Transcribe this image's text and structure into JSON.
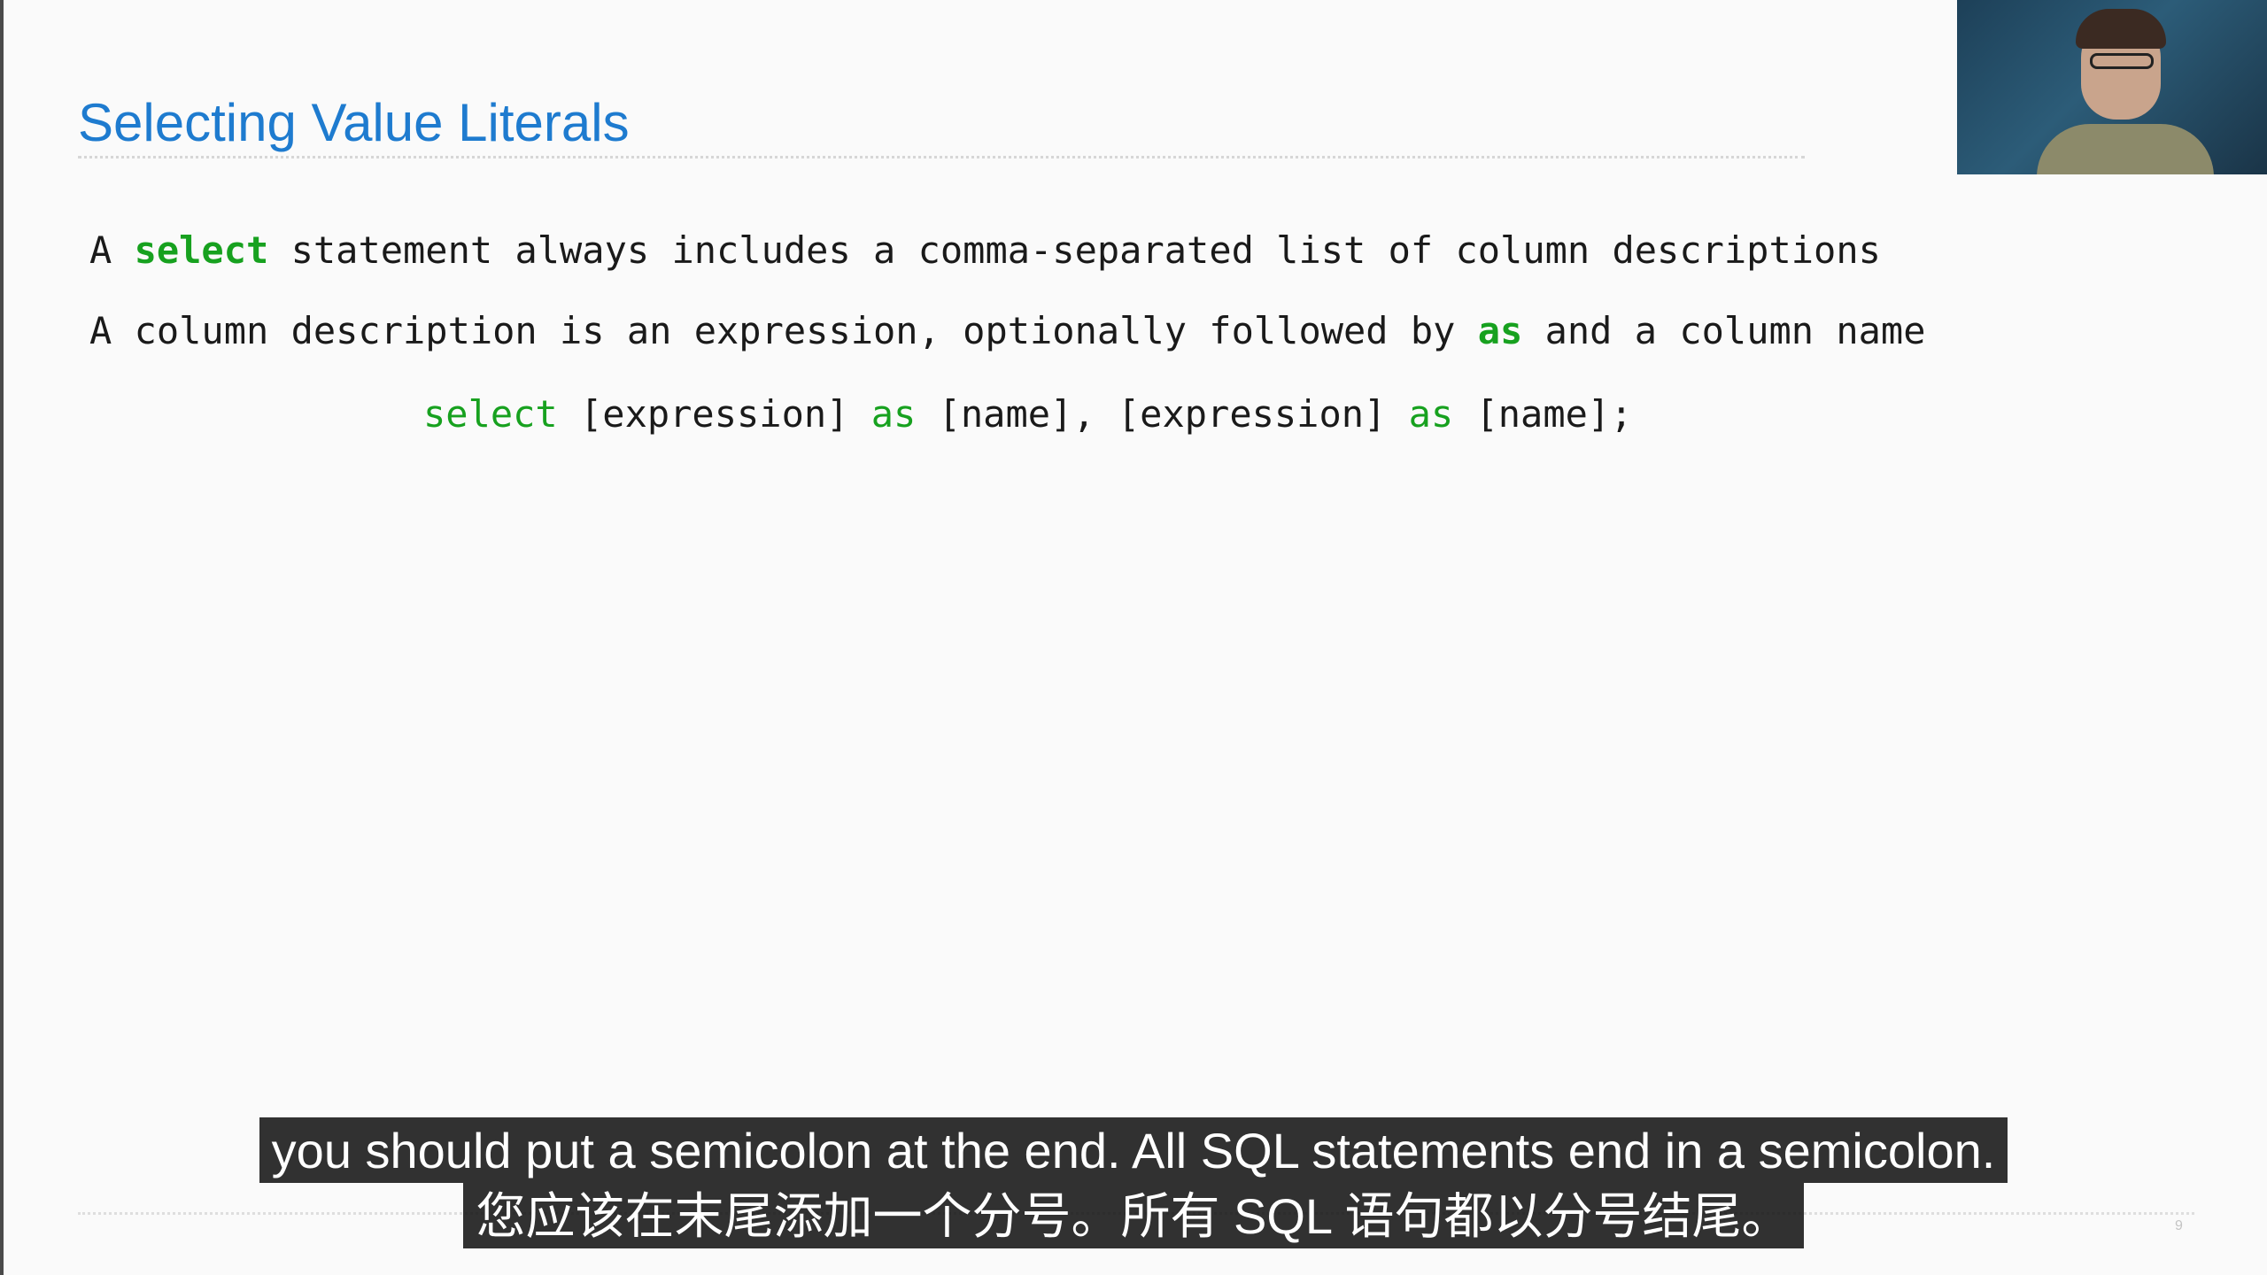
{
  "slide": {
    "title": "Selecting Value Literals",
    "line1": {
      "prefix": "A ",
      "keyword": "select",
      "suffix": " statement always includes a comma-separated list of column descriptions"
    },
    "line2": {
      "prefix": "A column description is an expression, optionally followed by ",
      "keyword": "as",
      "suffix": " and a column name"
    },
    "syntax": {
      "kw_select": "select",
      "part1": " [expression] ",
      "kw_as1": "as",
      "part2": " [name], [expression] ",
      "kw_as2": "as",
      "part3": " [name];"
    },
    "page_number": "9",
    "colors": {
      "title": "#1e7bcf",
      "keyword": "#17a11f",
      "text": "#1a1a1a",
      "background": "#fafafa"
    }
  },
  "subtitles": {
    "english": "you should put a semicolon at the end. All SQL statements end in a semicolon.",
    "chinese": "您应该在末尾添加一个分号。所有 SQL 语句都以分号结尾。"
  },
  "webcam": {
    "icon": "presenter-video-thumbnail"
  }
}
